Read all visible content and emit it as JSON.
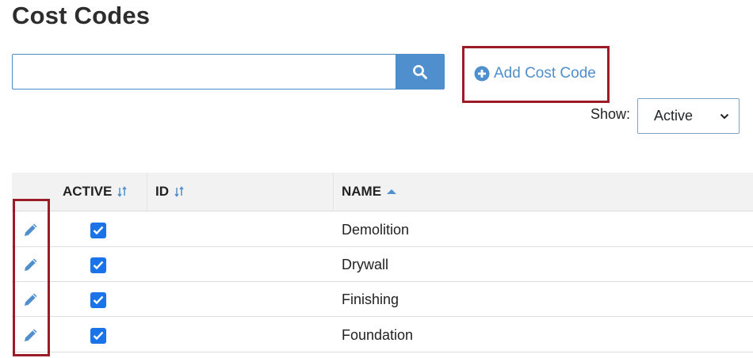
{
  "page": {
    "title": "Cost Codes"
  },
  "search": {
    "value": "",
    "placeholder": "",
    "button_icon": "search-icon"
  },
  "add_link": {
    "label": "Add Cost Code",
    "icon": "plus-circle-icon"
  },
  "filter": {
    "label": "Show:",
    "selected": "Active"
  },
  "table": {
    "columns": [
      {
        "label": "ACTIVE",
        "sort": "sort-toggle-icon"
      },
      {
        "label": "ID",
        "sort": "sort-toggle-icon"
      },
      {
        "label": "NAME",
        "sort": "sort-ascending-icon"
      }
    ],
    "rows": [
      {
        "active": true,
        "id": "",
        "name": "Demolition"
      },
      {
        "active": true,
        "id": "",
        "name": "Drywall"
      },
      {
        "active": true,
        "id": "",
        "name": "Finishing"
      },
      {
        "active": true,
        "id": "",
        "name": "Foundation"
      }
    ]
  },
  "colors": {
    "accent": "#4f8fcd",
    "highlight": "#9b1c24",
    "checkbox": "#1a73e8",
    "header_bg": "#f2f2f2"
  }
}
